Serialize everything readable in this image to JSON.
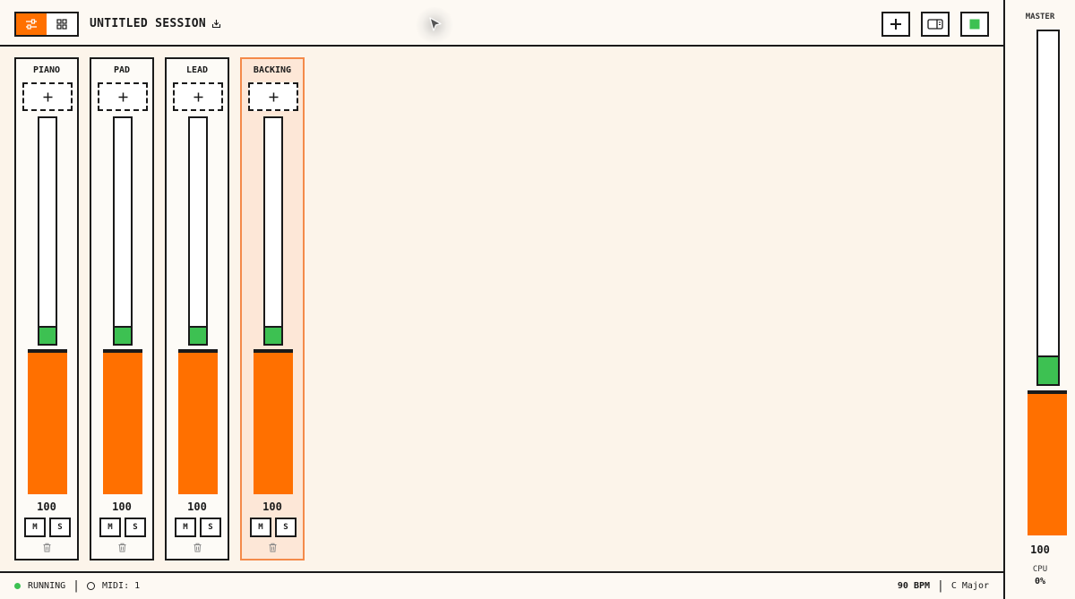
{
  "header": {
    "session_title": "UNTITLED SESSION",
    "view_modes": [
      {
        "name": "mixer",
        "icon": "sliders-icon",
        "active": true
      },
      {
        "name": "grid",
        "icon": "grid-icon",
        "active": false
      }
    ],
    "actions": [
      {
        "name": "add-channel",
        "icon": "plus-icon"
      },
      {
        "name": "toggle-panel",
        "icon": "panel-icon"
      },
      {
        "name": "stop",
        "icon": "stop-square-icon"
      }
    ]
  },
  "channels": [
    {
      "name": "PIANO",
      "volume": "100",
      "meter_level": 0.08,
      "fader_level": 1.0,
      "selected": false,
      "mute_label": "M",
      "solo_label": "S"
    },
    {
      "name": "PAD",
      "volume": "100",
      "meter_level": 0.08,
      "fader_level": 1.0,
      "selected": false,
      "mute_label": "M",
      "solo_label": "S"
    },
    {
      "name": "LEAD",
      "volume": "100",
      "meter_level": 0.08,
      "fader_level": 1.0,
      "selected": false,
      "mute_label": "M",
      "solo_label": "S"
    },
    {
      "name": "BACKING",
      "volume": "100",
      "meter_level": 0.08,
      "fader_level": 1.0,
      "selected": true,
      "mute_label": "M",
      "solo_label": "S"
    }
  ],
  "status": {
    "running": "RUNNING",
    "midi": "MIDI: 1",
    "bpm": "90 BPM",
    "key": "C Major",
    "running_color": "#3dc152"
  },
  "master": {
    "label": "MASTER",
    "volume": "100",
    "meter_level": 0.08,
    "fader_level": 1.0,
    "cpu_label": "CPU",
    "cpu_value": "0%"
  },
  "colors": {
    "accent": "#ff7000",
    "meter": "#3dc152",
    "selected_border": "#f48a4a",
    "selected_bg": "#fde7d7"
  }
}
